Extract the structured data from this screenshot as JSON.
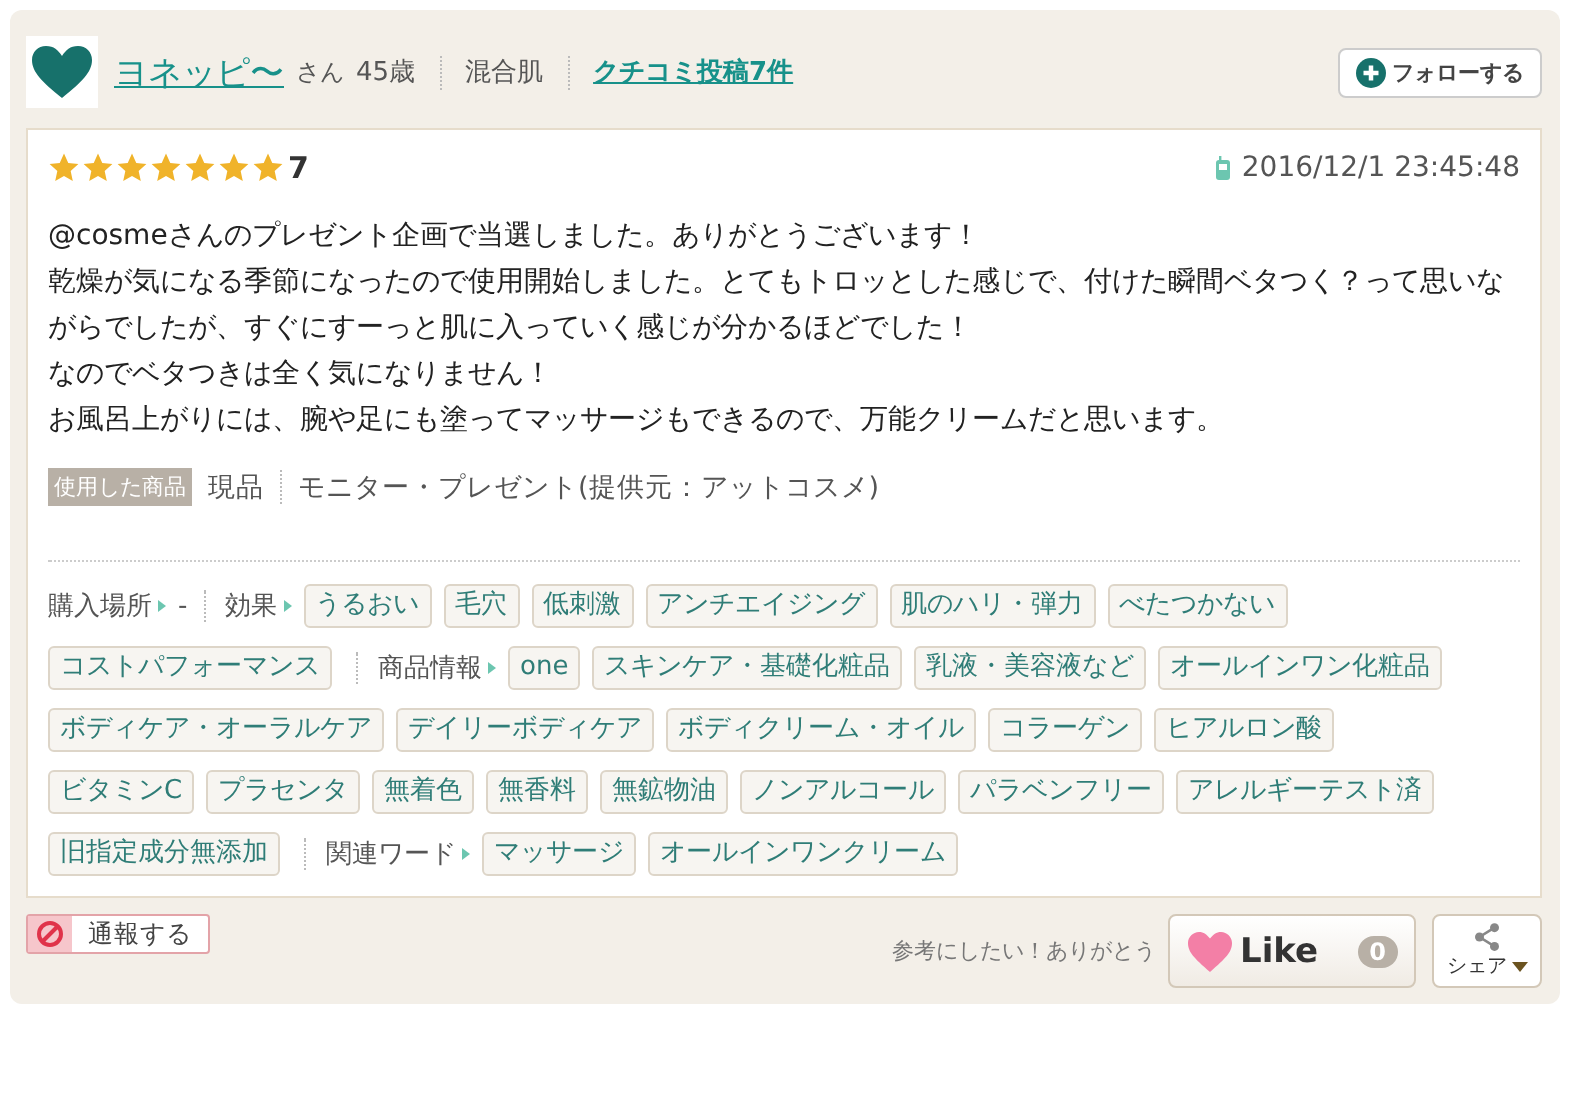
{
  "user": {
    "name": "ヨネッピ〜",
    "honorific": "さん",
    "age": "45歳",
    "skin": "混合肌",
    "posts": "クチコミ投稿7件"
  },
  "follow_button": "フォローする",
  "review": {
    "stars": 7,
    "score": "7",
    "date": "2016/12/1 23:45:48",
    "paragraphs": [
      "@cosmeさんのプレゼント企画で当選しました。ありがとうございます！",
      "乾燥が気になる季節になったので使用開始しました。とてもトロッとした感じで、付けた瞬間ベタつく？って思いながらでしたが、すぐにすーっと肌に入っていく感じが分かるほどでした！",
      "なのでベタつきは全く気になりません！",
      "お風呂上がりには、腕や足にも塗ってマッサージもできるので、万能クリームだと思います。"
    ],
    "used_label": "使用した商品",
    "used_kind": "現品",
    "used_source": "モニター・プレゼント(提供元：アットコスメ)"
  },
  "tag_groups": [
    {
      "label": "購入場所",
      "value": "-"
    },
    {
      "label": "効果",
      "tags": [
        "うるおい",
        "毛穴",
        "低刺激",
        "アンチエイジング",
        "肌のハリ・弾力",
        "べたつかない",
        "コストパフォーマンス"
      ]
    },
    {
      "label": "商品情報",
      "tags": [
        "one",
        "スキンケア・基礎化粧品",
        "乳液・美容液など",
        "オールインワン化粧品",
        "ボディケア・オーラルケア",
        "デイリーボディケア",
        "ボディクリーム・オイル",
        "コラーゲン",
        "ヒアルロン酸",
        "ビタミンC",
        "プラセンタ",
        "無着色",
        "無香料",
        "無鉱物油",
        "ノンアルコール",
        "パラベンフリー",
        "アレルギーテスト済",
        "旧指定成分無添加"
      ]
    },
    {
      "label": "関連ワード",
      "tags": [
        "マッサージ",
        "オールインワンクリーム"
      ]
    }
  ],
  "report_button": "通報する",
  "like": {
    "prompt": "参考にしたい！ありがとう",
    "label": "Like",
    "count": "0"
  },
  "share_button": "シェア"
}
